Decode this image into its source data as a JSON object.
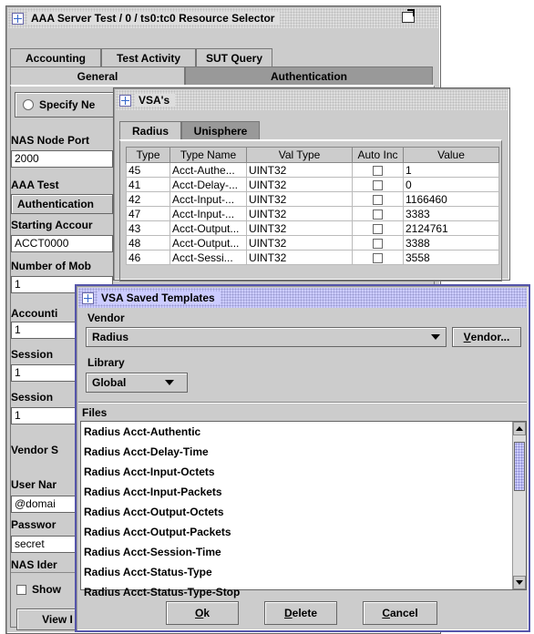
{
  "main_window": {
    "title": "AAA Server Test / 0 / ts0:tc0 Resource Selector",
    "tabs_row1": [
      "Accounting",
      "Test Activity",
      "SUT Query"
    ],
    "tabs_row2": [
      "General",
      "Authentication"
    ],
    "radio_label": "Specify Ne",
    "nas_node_port_label": "NAS Node Port",
    "nas_node_port_value": "2000",
    "aaa_test_label": "AAA Test",
    "aaa_test_value": "Authentication",
    "starting_account_label": "Starting Accour",
    "starting_account_value": "ACCT0000",
    "number_of_mob_label": "Number of Mob",
    "number_of_mob_value": "1",
    "accounting_label": "Accounti",
    "accounting_value": "1",
    "session_label_1": "Session",
    "session_value_1": "1",
    "session_label_2": "Session",
    "session_value_2": "1",
    "vendor_label": "Vendor S",
    "user_name_label": "User Nar",
    "user_name_value": "@domai",
    "password_label": "Passwor",
    "password_value": "secret",
    "nas_ident_label": "NAS Ider",
    "show_label": "Show",
    "view_button": "View I"
  },
  "vsa_window": {
    "title": "VSA's",
    "tabs": [
      "Radius",
      "Unisphere"
    ],
    "columns": [
      "Type",
      "Type Name",
      "Val Type",
      "Auto Inc",
      "Value"
    ],
    "rows": [
      {
        "type": "45",
        "name": "Acct-Authe...",
        "val_type": "UINT32",
        "value": "1"
      },
      {
        "type": "41",
        "name": "Acct-Delay-...",
        "val_type": "UINT32",
        "value": "0"
      },
      {
        "type": "42",
        "name": "Acct-Input-...",
        "val_type": "UINT32",
        "value": "1166460"
      },
      {
        "type": "47",
        "name": "Acct-Input-...",
        "val_type": "UINT32",
        "value": "3383"
      },
      {
        "type": "43",
        "name": "Acct-Output...",
        "val_type": "UINT32",
        "value": "2124761"
      },
      {
        "type": "48",
        "name": "Acct-Output...",
        "val_type": "UINT32",
        "value": "3388"
      },
      {
        "type": "46",
        "name": "Acct-Sessi...",
        "val_type": "UINT32",
        "value": "3558"
      }
    ]
  },
  "templates_window": {
    "title": "VSA Saved Templates",
    "vendor_label": "Vendor",
    "vendor_value": "Radius",
    "vendor_button_u": "V",
    "vendor_button_rest": "endor...",
    "library_label": "Library",
    "library_value": "Global",
    "files_label": "Files",
    "files": [
      "Radius Acct-Authentic",
      "Radius Acct-Delay-Time",
      "Radius Acct-Input-Octets",
      "Radius Acct-Input-Packets",
      "Radius Acct-Output-Octets",
      "Radius Acct-Output-Packets",
      "Radius Acct-Session-Time",
      "Radius Acct-Status-Type",
      "Radius Acct-Status-Type-Stop"
    ],
    "ok_u": "O",
    "ok_rest": "k",
    "delete_u": "D",
    "delete_rest": "elete",
    "cancel_u": "C",
    "cancel_rest": "ancel"
  },
  "colors": {
    "window_bg": "#cccccc",
    "title_active": "#ccccff",
    "title_inactive": "#dddddd"
  }
}
